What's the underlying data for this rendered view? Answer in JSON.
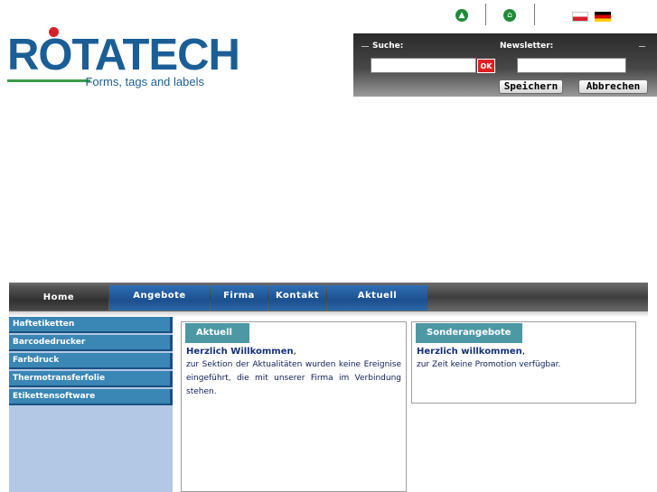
{
  "top_icons": {
    "icon1": "sitemap-icon",
    "icon2": "home-icon",
    "flag_pl": "Polski",
    "flag_de": "Deutsch"
  },
  "logo": {
    "word": "ROTATECH",
    "tagline": "Forms, tags and labels"
  },
  "search_panel": {
    "search_label": "Suche:",
    "newsletter_label": "Newsletter:",
    "search_value": "",
    "newsletter_value": "",
    "ok_label": "OK",
    "save_label": "Speichern",
    "cancel_label": "Abbrechen"
  },
  "nav": {
    "items": [
      {
        "label": "Home"
      },
      {
        "label": "Angebote"
      },
      {
        "label": "Firma"
      },
      {
        "label": "Kontakt"
      },
      {
        "label": "Aktuell"
      }
    ]
  },
  "sidebar": {
    "items": [
      {
        "label": "Haftetiketten"
      },
      {
        "label": "Barcodedrucker"
      },
      {
        "label": "Farbdruck"
      },
      {
        "label": "Thermotransferfolie"
      },
      {
        "label": "Etikettensoftware"
      }
    ]
  },
  "news": {
    "tab": "Aktuell",
    "heading": "Herzlich Willkommen",
    "text": "zur Sektion der Aktualitäten wurden keine Ereignise eingeführt, die mit unserer Firma im Verbindung stehen."
  },
  "offers": {
    "tab": "Sonderangebote",
    "heading": "Herzlich willkommen",
    "text": "zur Zeit keine Promotion verfügbar."
  },
  "colors": {
    "brand_blue": "#1b5e96",
    "brand_red": "#d42027",
    "brand_green": "#3d9c49",
    "nav_blue": "#1d4f8e",
    "sidebar_bg": "#b3c8e5",
    "tab_teal": "#4d98a5"
  }
}
